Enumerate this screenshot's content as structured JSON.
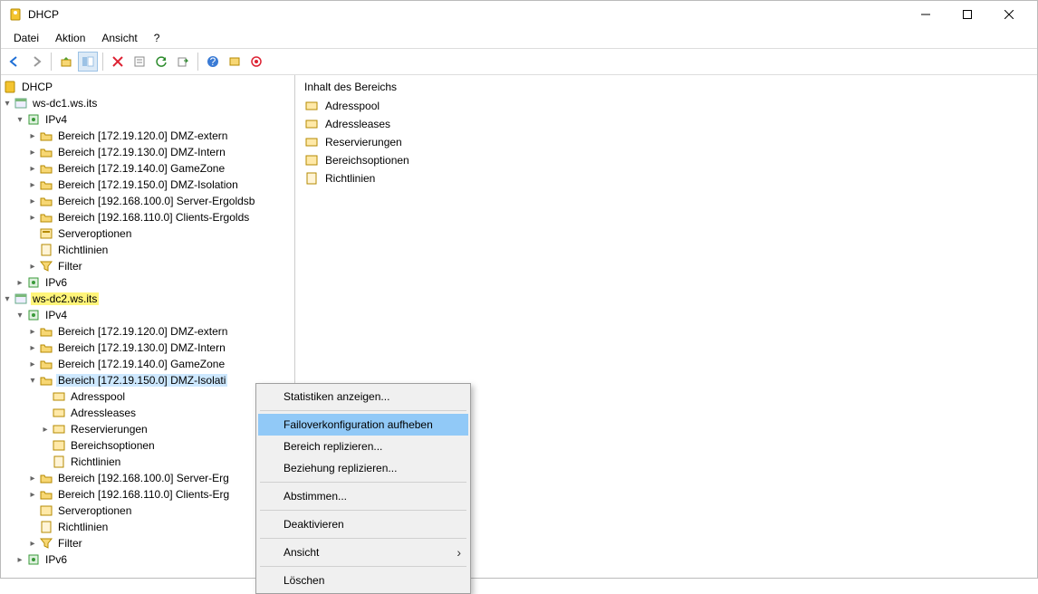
{
  "window": {
    "title": "DHCP"
  },
  "menu": {
    "items": [
      "Datei",
      "Aktion",
      "Ansicht",
      "?"
    ]
  },
  "tree": {
    "root": "DHCP",
    "server1": {
      "name": "ws-dc1.ws.its",
      "ipv4": "IPv4",
      "ipv6": "IPv6",
      "scopes": [
        "Bereich [172.19.120.0] DMZ-extern",
        "Bereich [172.19.130.0] DMZ-Intern",
        "Bereich [172.19.140.0] GameZone",
        "Bereich [172.19.150.0] DMZ-Isolation",
        "Bereich [192.168.100.0] Server-Ergoldsb",
        "Bereich [192.168.110.0] Clients-Ergolds"
      ],
      "serveroptions": "Serveroptionen",
      "policies": "Richtlinien",
      "filter": "Filter"
    },
    "server2": {
      "name": "ws-dc2.ws.its",
      "ipv4": "IPv4",
      "ipv6": "IPv6",
      "scopes": [
        "Bereich [172.19.120.0] DMZ-extern",
        "Bereich [172.19.130.0] DMZ-Intern",
        "Bereich [172.19.140.0] GameZone",
        "Bereich [172.19.150.0] DMZ-Isolati"
      ],
      "scope4children": {
        "pool": "Adresspool",
        "leases": "Adressleases",
        "reservations": "Reservierungen",
        "options": "Bereichsoptionen",
        "policies": "Richtlinien"
      },
      "more_scopes": [
        "Bereich [192.168.100.0] Server-Erg",
        "Bereich [192.168.110.0] Clients-Erg"
      ],
      "serveroptions": "Serveroptionen",
      "policies": "Richtlinien",
      "filter": "Filter"
    }
  },
  "rightpane": {
    "header": "Inhalt des Bereichs",
    "items": [
      "Adresspool",
      "Adressleases",
      "Reservierungen",
      "Bereichsoptionen",
      "Richtlinien"
    ]
  },
  "context": {
    "items": [
      "Statistiken anzeigen...",
      "Failoverkonfiguration aufheben",
      "Bereich replizieren...",
      "Beziehung replizieren...",
      "Abstimmen...",
      "Deaktivieren",
      "Ansicht",
      "Löschen"
    ]
  }
}
